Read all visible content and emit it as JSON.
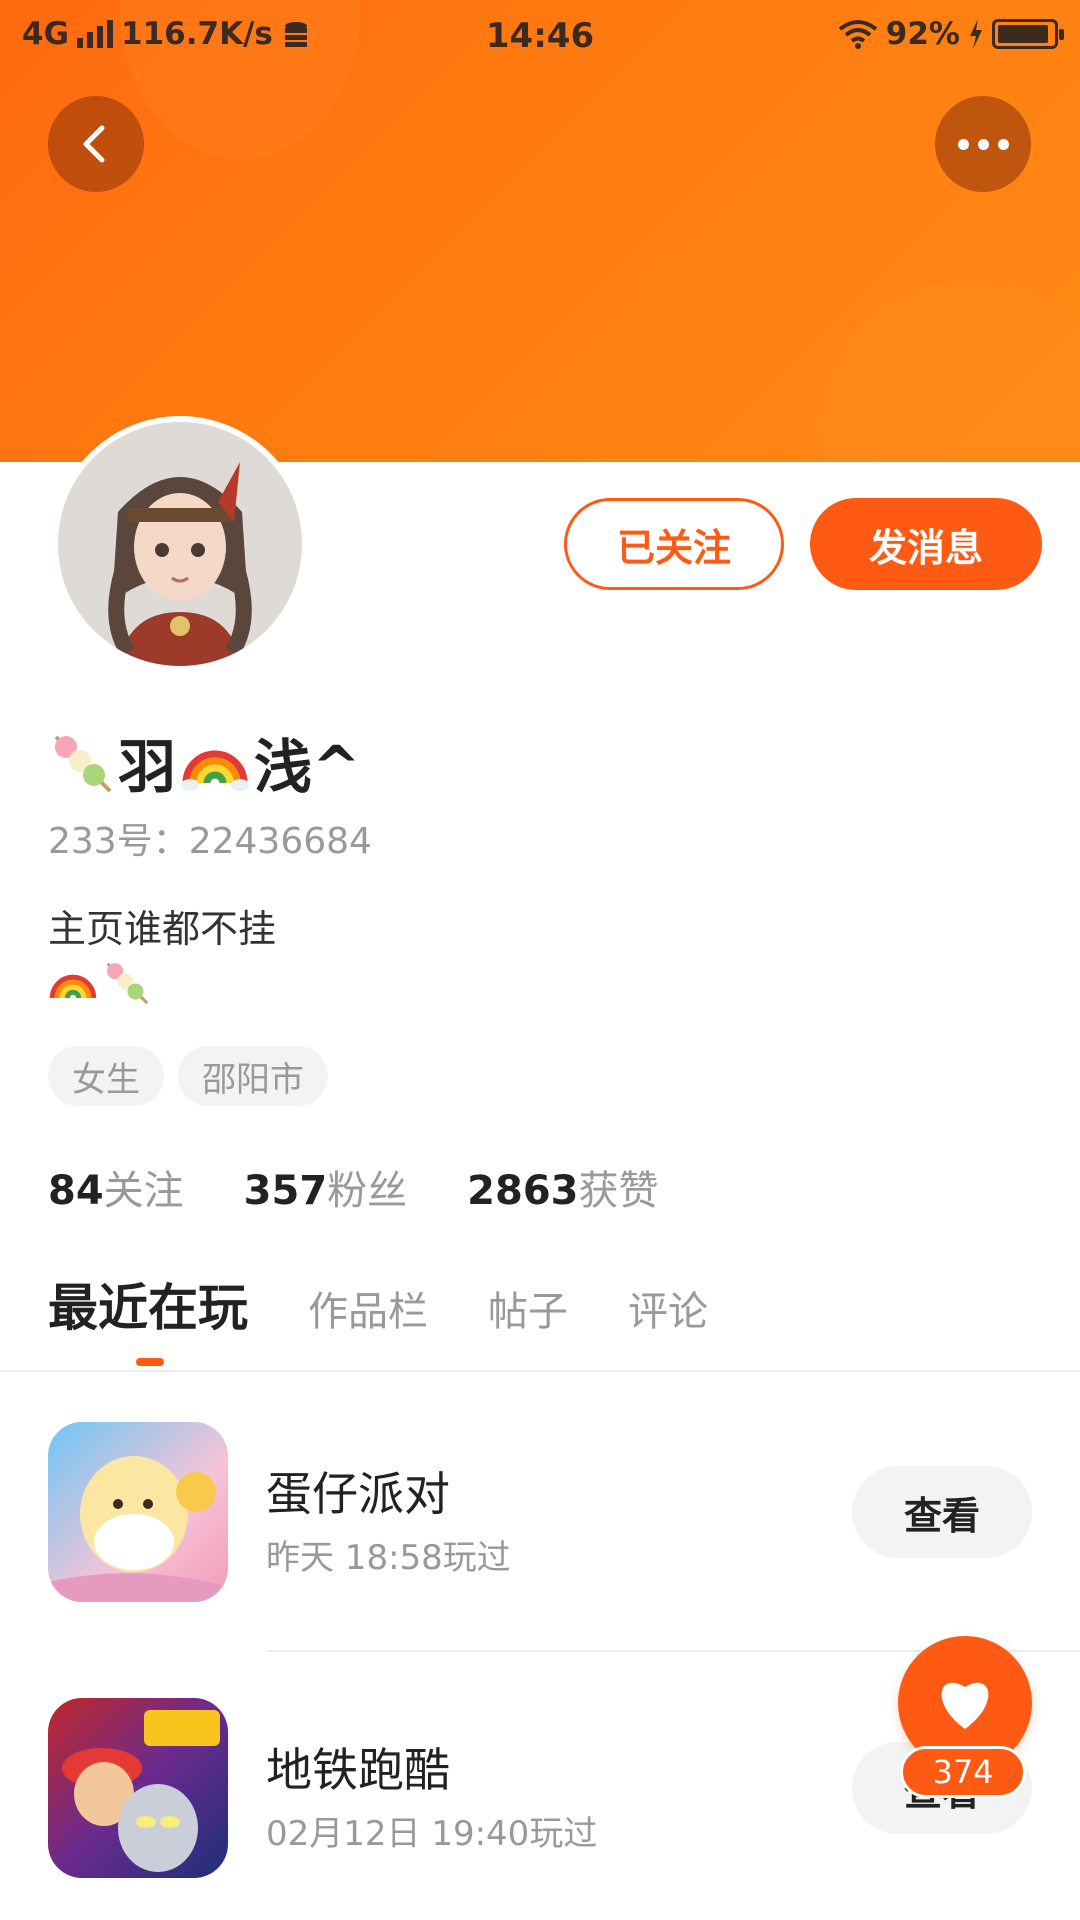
{
  "status_bar": {
    "network": "4G",
    "speed": "116.7K/s",
    "time": "14:46",
    "battery_percent": "92%",
    "battery_level": 0.92
  },
  "header": {
    "back_icon": "chevron-left-icon",
    "more_icon": "more-dots-icon",
    "color": "#ff6a10"
  },
  "profile": {
    "nickname_part1": "羽",
    "nickname_part2": "浅^",
    "id_text": "233号：22436684",
    "bio": "主页谁都不挂",
    "tags": [
      "女生",
      "邵阳市"
    ],
    "follow_label": "已关注",
    "message_label": "发消息"
  },
  "stats": [
    {
      "num": "84",
      "label": "关注"
    },
    {
      "num": "357",
      "label": "粉丝"
    },
    {
      "num": "2863",
      "label": "获赞"
    }
  ],
  "tabs": [
    "最近在玩",
    "作品栏",
    "帖子",
    "评论"
  ],
  "games": [
    {
      "name": "蛋仔派对",
      "time": "昨天 18:58玩过",
      "button": "查看"
    },
    {
      "name": "地铁跑酷",
      "time": "02月12日 19:40玩过",
      "button": "查看"
    }
  ],
  "like_fab": {
    "icon": "heart-icon",
    "count": "374"
  },
  "accent": "#ff5a14"
}
